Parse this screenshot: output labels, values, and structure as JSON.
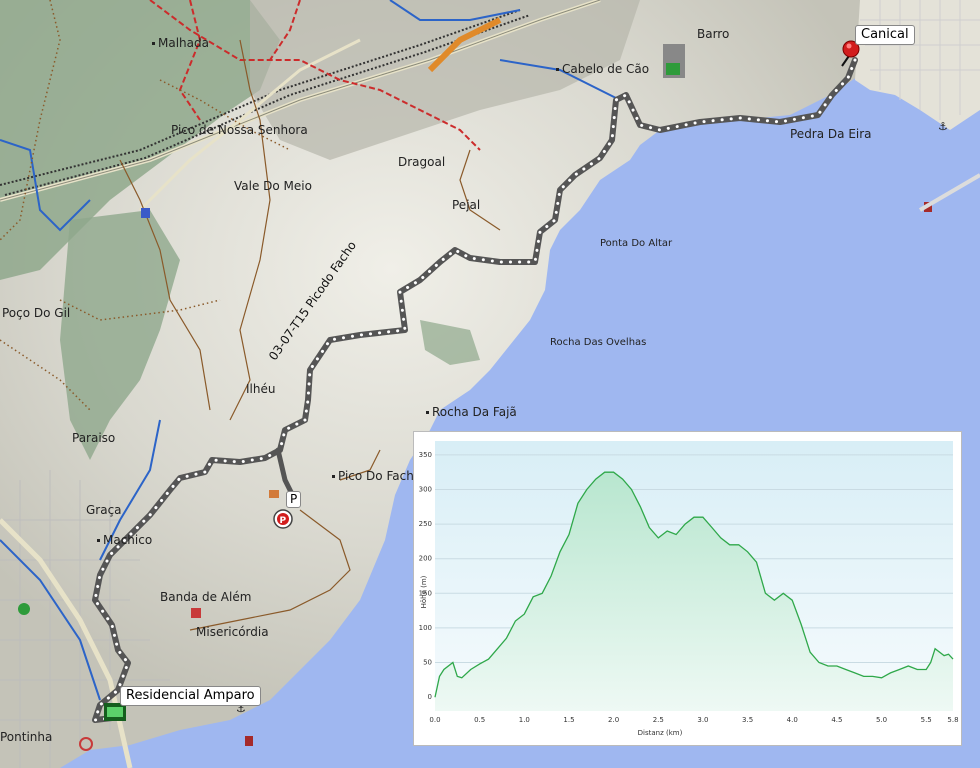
{
  "map": {
    "route_name": "03-07-T15 Picodo Facho",
    "callouts": {
      "end": "Canical",
      "start": "Residencial Amparo"
    },
    "places": [
      {
        "id": "malhada",
        "name": "Malhada"
      },
      {
        "id": "pico-nossa-senhora",
        "name": "Pico de Nossa Senhora"
      },
      {
        "id": "vale-do-meio",
        "name": "Vale Do Meio"
      },
      {
        "id": "dragoal",
        "name": "Dragoal"
      },
      {
        "id": "pejal",
        "name": "Pejal"
      },
      {
        "id": "cabelo-de-cao",
        "name": "Cabelo de Cão"
      },
      {
        "id": "barro",
        "name": "Barro"
      },
      {
        "id": "pedra-da-eira",
        "name": "Pedra Da Eira"
      },
      {
        "id": "ponta-do-altar",
        "name": "Ponta Do Altar"
      },
      {
        "id": "rocha-das-ovelhas",
        "name": "Rocha Das Ovelhas"
      },
      {
        "id": "rocha-da-faja",
        "name": "Rocha Da Fajã"
      },
      {
        "id": "pico-do-facho",
        "name": "Pico Do Facho"
      },
      {
        "id": "poco-do-gil",
        "name": "Poço Do Gil"
      },
      {
        "id": "ilheu",
        "name": "Ilhéu"
      },
      {
        "id": "paraiso",
        "name": "Paraiso"
      },
      {
        "id": "graca",
        "name": "Graça"
      },
      {
        "id": "machico",
        "name": "Machico"
      },
      {
        "id": "banda-de-alem",
        "name": "Banda de Além"
      },
      {
        "id": "misericordia",
        "name": "Misericórdia"
      },
      {
        "id": "pontinha",
        "name": "Pontinha"
      }
    ],
    "parking_label": "P",
    "colors": {
      "sea": "#9fb7f0",
      "land": "#d4d2c6",
      "hill": "#8fa88c",
      "route": "#555555",
      "road_red": "#cc2b2b",
      "road_blue": "#2c64c8",
      "trail": "#8a5a2a"
    }
  },
  "chart_data": {
    "type": "area",
    "xlabel": "Distanz (km)",
    "ylabel": "Höhe (m)",
    "xlim": [
      0,
      5.8
    ],
    "ylim": [
      -20,
      370
    ],
    "xticks": [
      "0.0",
      "0.5",
      "1.0",
      "1.5",
      "2.0",
      "2.5",
      "3.0",
      "3.5",
      "4.0",
      "4.5",
      "5.0",
      "5.5",
      "5.8"
    ],
    "yticks": [
      "0",
      "50",
      "100",
      "150",
      "200",
      "250",
      "300",
      "350"
    ],
    "x": [
      0,
      0.05,
      0.1,
      0.2,
      0.25,
      0.3,
      0.4,
      0.5,
      0.6,
      0.7,
      0.8,
      0.9,
      1.0,
      1.1,
      1.2,
      1.3,
      1.4,
      1.5,
      1.6,
      1.7,
      1.8,
      1.9,
      2.0,
      2.1,
      2.2,
      2.3,
      2.4,
      2.5,
      2.6,
      2.7,
      2.8,
      2.9,
      3.0,
      3.1,
      3.2,
      3.3,
      3.4,
      3.5,
      3.6,
      3.7,
      3.8,
      3.9,
      4.0,
      4.1,
      4.2,
      4.3,
      4.4,
      4.5,
      4.6,
      4.7,
      4.8,
      4.9,
      5.0,
      5.1,
      5.2,
      5.3,
      5.4,
      5.5,
      5.55,
      5.6,
      5.7,
      5.75,
      5.8
    ],
    "values": [
      0,
      30,
      40,
      50,
      30,
      28,
      40,
      48,
      55,
      70,
      85,
      110,
      120,
      145,
      150,
      175,
      210,
      235,
      280,
      300,
      315,
      325,
      325,
      315,
      300,
      275,
      245,
      230,
      240,
      235,
      250,
      260,
      260,
      245,
      230,
      220,
      220,
      210,
      195,
      150,
      140,
      150,
      140,
      105,
      65,
      50,
      45,
      45,
      40,
      35,
      30,
      30,
      28,
      35,
      40,
      45,
      40,
      40,
      50,
      70,
      60,
      62,
      55
    ]
  }
}
